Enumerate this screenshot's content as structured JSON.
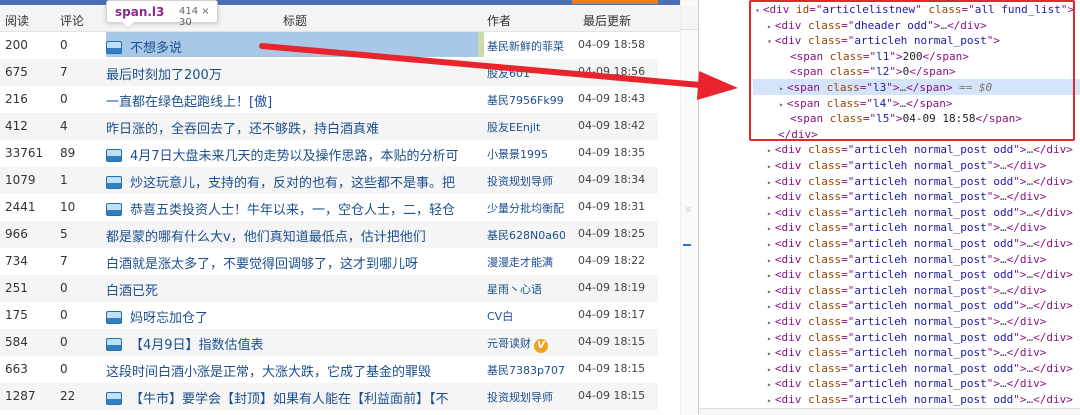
{
  "table": {
    "headers": [
      "阅读",
      "评论",
      "标题",
      "作者",
      "最后更新"
    ],
    "rows": [
      {
        "reads": "200",
        "comments": "0",
        "title": "不想多说",
        "author": "基民新鲜的菲菜",
        "time": "04-09 18:58",
        "icon": true,
        "badge": false
      },
      {
        "reads": "675",
        "comments": "7",
        "title": "最后时刻加了200万",
        "author": "股友601",
        "time": "04-09 18:56",
        "icon": false,
        "badge": false
      },
      {
        "reads": "216",
        "comments": "0",
        "title": "一直都在绿色起跑线上！[傲]",
        "author": "基民7956Fk997",
        "time": "04-09 18:43",
        "icon": false,
        "badge": false
      },
      {
        "reads": "412",
        "comments": "4",
        "title": "昨日涨的，全吞回去了，还不够跌，持白酒真难",
        "author": "股友EEnjlt",
        "time": "04-09 18:42",
        "icon": false,
        "badge": false
      },
      {
        "reads": "33761",
        "comments": "89",
        "title": "4月7日大盘未来几天的走势以及操作思路，本贴的分析可",
        "author": "小景景1995",
        "time": "04-09 18:35",
        "icon": true,
        "badge": false
      },
      {
        "reads": "1079",
        "comments": "1",
        "title": "炒这玩意儿，支持的有，反对的也有，这些都不是事。把",
        "author": "投资规划导师",
        "time": "04-09 18:34",
        "icon": true,
        "badge": false
      },
      {
        "reads": "2441",
        "comments": "10",
        "title": "恭喜五类投资人士！牛年以来，一，空仓人士，二，轻仓",
        "author": "少量分批均衡配",
        "time": "04-09 18:31",
        "icon": true,
        "badge": false
      },
      {
        "reads": "966",
        "comments": "5",
        "title": "都是蒙的哪有什么大v，他们真知道最低点，估计把他们",
        "author": "基民628N0a60",
        "time": "04-09 18:25",
        "icon": false,
        "badge": false
      },
      {
        "reads": "734",
        "comments": "7",
        "title": "白酒就是涨太多了，不要觉得回调够了，这才到哪儿呀",
        "author": "漫漫走才能满",
        "time": "04-09 18:22",
        "icon": false,
        "badge": false
      },
      {
        "reads": "251",
        "comments": "0",
        "title": "白酒已死",
        "author": "星雨丶心语",
        "time": "04-09 18:19",
        "icon": false,
        "badge": false
      },
      {
        "reads": "175",
        "comments": "0",
        "title": "妈呀忘加仓了",
        "author": "CV白",
        "time": "04-09 18:17",
        "icon": true,
        "badge": false
      },
      {
        "reads": "584",
        "comments": "0",
        "title": "【4月9日】指数估值表",
        "author": "元哥读财",
        "time": "04-09 18:15",
        "icon": true,
        "badge": true
      },
      {
        "reads": "663",
        "comments": "0",
        "title": "这段时间白酒小涨是正常，大涨大跌，它成了基金的罪毁",
        "author": "基民7383p7072",
        "time": "04-09 18:15",
        "icon": false,
        "badge": false
      },
      {
        "reads": "1287",
        "comments": "22",
        "title": "【牛市】要学会【封顶】如果有人能在【利益面前】【不",
        "author": "投资规划导师",
        "time": "04-09 18:15",
        "icon": true,
        "badge": false
      }
    ]
  },
  "tooltip": {
    "name": "span.l3",
    "size": "414 × 30"
  },
  "badge_label": "V",
  "devtools": {
    "lines": [
      {
        "indent": 0,
        "tri": "▾",
        "parts": [
          [
            "tag",
            "<div "
          ],
          [
            "an",
            "id"
          ],
          [
            "tag",
            "=\""
          ],
          [
            "av",
            "articlelistnew"
          ],
          [
            "tag",
            "\" "
          ],
          [
            "an",
            "class"
          ],
          [
            "tag",
            "=\""
          ],
          [
            "av",
            "all fund_list"
          ],
          [
            "tag",
            "\">"
          ]
        ]
      },
      {
        "indent": 1,
        "tri": "▸",
        "parts": [
          [
            "tag",
            "<div "
          ],
          [
            "an",
            "class"
          ],
          [
            "tag",
            "=\""
          ],
          [
            "av",
            "dheader odd"
          ],
          [
            "tag",
            "\">"
          ],
          [
            "dim",
            "…"
          ],
          [
            "tag",
            "</div>"
          ]
        ]
      },
      {
        "indent": 1,
        "tri": "▾",
        "parts": [
          [
            "tag",
            "<div "
          ],
          [
            "an",
            "class"
          ],
          [
            "tag",
            "=\""
          ],
          [
            "av",
            "articleh normal_post"
          ],
          [
            "tag",
            "\">"
          ]
        ]
      },
      {
        "indent": 2,
        "tri": "",
        "parts": [
          [
            "tag",
            "<span "
          ],
          [
            "an",
            "class"
          ],
          [
            "tag",
            "=\""
          ],
          [
            "av",
            "l1"
          ],
          [
            "tag",
            "\">"
          ],
          [
            "txt",
            "200"
          ],
          [
            "tag",
            "</span>"
          ]
        ]
      },
      {
        "indent": 2,
        "tri": "",
        "parts": [
          [
            "tag",
            "<span "
          ],
          [
            "an",
            "class"
          ],
          [
            "tag",
            "=\""
          ],
          [
            "av",
            "l2"
          ],
          [
            "tag",
            "\">"
          ],
          [
            "txt",
            "0"
          ],
          [
            "tag",
            "</span>"
          ]
        ]
      },
      {
        "indent": 2,
        "tri": "▸",
        "parts": [
          [
            "tag",
            "<span "
          ],
          [
            "an",
            "class"
          ],
          [
            "tag",
            "=\""
          ],
          [
            "av",
            "l3"
          ],
          [
            "tag",
            "\">"
          ],
          [
            "dim",
            "…"
          ],
          [
            "tag",
            "</span>"
          ],
          [
            "dollar",
            " == $0"
          ]
        ]
      },
      {
        "indent": 2,
        "tri": "▸",
        "parts": [
          [
            "tag",
            "<span "
          ],
          [
            "an",
            "class"
          ],
          [
            "tag",
            "=\""
          ],
          [
            "av",
            "l4"
          ],
          [
            "tag",
            "\">"
          ],
          [
            "dim",
            "…"
          ],
          [
            "tag",
            "</span>"
          ]
        ]
      },
      {
        "indent": 2,
        "tri": "",
        "parts": [
          [
            "tag",
            "<span "
          ],
          [
            "an",
            "class"
          ],
          [
            "tag",
            "=\""
          ],
          [
            "av",
            "l5"
          ],
          [
            "tag",
            "\">"
          ],
          [
            "txt",
            "04-09 18:58"
          ],
          [
            "tag",
            "</span>"
          ]
        ]
      },
      {
        "indent": 1,
        "tri": "",
        "parts": [
          [
            "tag",
            "</div>"
          ]
        ]
      },
      {
        "indent": 1,
        "tri": "▸",
        "parts": [
          [
            "tag",
            "<div "
          ],
          [
            "an",
            "class"
          ],
          [
            "tag",
            "=\""
          ],
          [
            "av",
            "articleh normal_post odd"
          ],
          [
            "tag",
            "\">"
          ],
          [
            "dim",
            "…"
          ],
          [
            "tag",
            "</div>"
          ]
        ]
      },
      {
        "indent": 1,
        "tri": "▸",
        "parts": [
          [
            "tag",
            "<div "
          ],
          [
            "an",
            "class"
          ],
          [
            "tag",
            "=\""
          ],
          [
            "av",
            "articleh normal_post"
          ],
          [
            "tag",
            "\">"
          ],
          [
            "dim",
            "…"
          ],
          [
            "tag",
            "</div>"
          ]
        ]
      },
      {
        "indent": 1,
        "tri": "▸",
        "parts": [
          [
            "tag",
            "<div "
          ],
          [
            "an",
            "class"
          ],
          [
            "tag",
            "=\""
          ],
          [
            "av",
            "articleh normal_post odd"
          ],
          [
            "tag",
            "\">"
          ],
          [
            "dim",
            "…"
          ],
          [
            "tag",
            "</div>"
          ]
        ]
      },
      {
        "indent": 1,
        "tri": "▸",
        "parts": [
          [
            "tag",
            "<div "
          ],
          [
            "an",
            "class"
          ],
          [
            "tag",
            "=\""
          ],
          [
            "av",
            "articleh normal_post"
          ],
          [
            "tag",
            "\">"
          ],
          [
            "dim",
            "…"
          ],
          [
            "tag",
            "</div>"
          ]
        ]
      },
      {
        "indent": 1,
        "tri": "▸",
        "parts": [
          [
            "tag",
            "<div "
          ],
          [
            "an",
            "class"
          ],
          [
            "tag",
            "=\""
          ],
          [
            "av",
            "articleh normal_post odd"
          ],
          [
            "tag",
            "\">"
          ],
          [
            "dim",
            "…"
          ],
          [
            "tag",
            "</div>"
          ]
        ]
      },
      {
        "indent": 1,
        "tri": "▸",
        "parts": [
          [
            "tag",
            "<div "
          ],
          [
            "an",
            "class"
          ],
          [
            "tag",
            "=\""
          ],
          [
            "av",
            "articleh normal_post"
          ],
          [
            "tag",
            "\">"
          ],
          [
            "dim",
            "…"
          ],
          [
            "tag",
            "</div>"
          ]
        ]
      },
      {
        "indent": 1,
        "tri": "▸",
        "parts": [
          [
            "tag",
            "<div "
          ],
          [
            "an",
            "class"
          ],
          [
            "tag",
            "=\""
          ],
          [
            "av",
            "articleh normal_post odd"
          ],
          [
            "tag",
            "\">"
          ],
          [
            "dim",
            "…"
          ],
          [
            "tag",
            "</div>"
          ]
        ]
      },
      {
        "indent": 1,
        "tri": "▸",
        "parts": [
          [
            "tag",
            "<div "
          ],
          [
            "an",
            "class"
          ],
          [
            "tag",
            "=\""
          ],
          [
            "av",
            "articleh normal_post"
          ],
          [
            "tag",
            "\">"
          ],
          [
            "dim",
            "…"
          ],
          [
            "tag",
            "</div>"
          ]
        ]
      },
      {
        "indent": 1,
        "tri": "▸",
        "parts": [
          [
            "tag",
            "<div "
          ],
          [
            "an",
            "class"
          ],
          [
            "tag",
            "=\""
          ],
          [
            "av",
            "articleh normal_post odd"
          ],
          [
            "tag",
            "\">"
          ],
          [
            "dim",
            "…"
          ],
          [
            "tag",
            "</div>"
          ]
        ]
      },
      {
        "indent": 1,
        "tri": "▸",
        "parts": [
          [
            "tag",
            "<div "
          ],
          [
            "an",
            "class"
          ],
          [
            "tag",
            "=\""
          ],
          [
            "av",
            "articleh normal_post"
          ],
          [
            "tag",
            "\">"
          ],
          [
            "dim",
            "…"
          ],
          [
            "tag",
            "</div>"
          ]
        ]
      },
      {
        "indent": 1,
        "tri": "▸",
        "parts": [
          [
            "tag",
            "<div "
          ],
          [
            "an",
            "class"
          ],
          [
            "tag",
            "=\""
          ],
          [
            "av",
            "articleh normal_post odd"
          ],
          [
            "tag",
            "\">"
          ],
          [
            "dim",
            "…"
          ],
          [
            "tag",
            "</div>"
          ]
        ]
      },
      {
        "indent": 1,
        "tri": "▸",
        "parts": [
          [
            "tag",
            "<div "
          ],
          [
            "an",
            "class"
          ],
          [
            "tag",
            "=\""
          ],
          [
            "av",
            "articleh normal_post"
          ],
          [
            "tag",
            "\">"
          ],
          [
            "dim",
            "…"
          ],
          [
            "tag",
            "</div>"
          ]
        ]
      },
      {
        "indent": 1,
        "tri": "▸",
        "parts": [
          [
            "tag",
            "<div "
          ],
          [
            "an",
            "class"
          ],
          [
            "tag",
            "=\""
          ],
          [
            "av",
            "articleh normal_post odd"
          ],
          [
            "tag",
            "\">"
          ],
          [
            "dim",
            "…"
          ],
          [
            "tag",
            "</div>"
          ]
        ]
      },
      {
        "indent": 1,
        "tri": "▸",
        "parts": [
          [
            "tag",
            "<div "
          ],
          [
            "an",
            "class"
          ],
          [
            "tag",
            "=\""
          ],
          [
            "av",
            "articleh normal_post"
          ],
          [
            "tag",
            "\">"
          ],
          [
            "dim",
            "…"
          ],
          [
            "tag",
            "</div>"
          ]
        ]
      },
      {
        "indent": 1,
        "tri": "▸",
        "parts": [
          [
            "tag",
            "<div "
          ],
          [
            "an",
            "class"
          ],
          [
            "tag",
            "=\""
          ],
          [
            "av",
            "articleh normal_post odd"
          ],
          [
            "tag",
            "\">"
          ],
          [
            "dim",
            "…"
          ],
          [
            "tag",
            "</div>"
          ]
        ]
      },
      {
        "indent": 1,
        "tri": "▸",
        "parts": [
          [
            "tag",
            "<div "
          ],
          [
            "an",
            "class"
          ],
          [
            "tag",
            "=\""
          ],
          [
            "av",
            "articleh normal_post"
          ],
          [
            "tag",
            "\">"
          ],
          [
            "dim",
            "…"
          ],
          [
            "tag",
            "</div>"
          ]
        ]
      },
      {
        "indent": 1,
        "tri": "▸",
        "parts": [
          [
            "tag",
            "<div "
          ],
          [
            "an",
            "class"
          ],
          [
            "tag",
            "=\""
          ],
          [
            "av",
            "articleh normal_post odd"
          ],
          [
            "tag",
            "\">"
          ],
          [
            "dim",
            "…"
          ],
          [
            "tag",
            "</div>"
          ]
        ]
      }
    ]
  },
  "colors": {
    "highlight": "#a9c8e8",
    "annotation_red": "#e8242c",
    "link": "#1c4f8f"
  }
}
